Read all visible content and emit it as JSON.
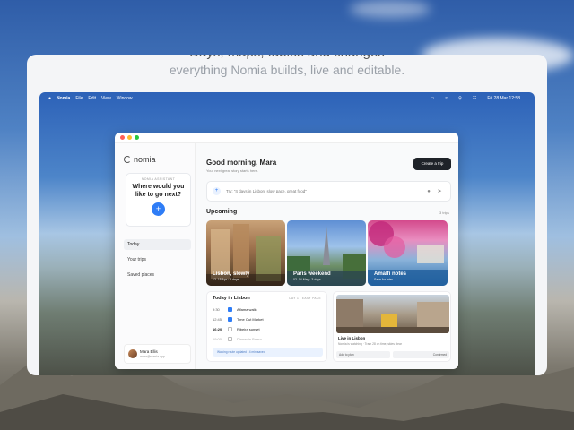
{
  "heading": {
    "line1": "Days, maps, tables and changes",
    "line2": "everything Nomia builds, live and editable."
  },
  "menubar": {
    "app": "Nomia",
    "items": [
      "File",
      "Edit",
      "View",
      "Window"
    ],
    "clock": "Fri 28 Mar 12:58"
  },
  "sidebar": {
    "logo": "nomia",
    "assistant_label": "NOMIA ASSISTANT",
    "assistant_question": "Where would you like to go next?",
    "nav": [
      "Today",
      "Your trips",
      "Saved places"
    ],
    "user_name": "Mara Ellis",
    "user_email": "mara@nomia.app"
  },
  "main": {
    "greeting": "Good morning, Mara",
    "subtitle": "Your next great story starts here.",
    "create_label": "Create a trip",
    "prompt_placeholder": "Try: \"4 days in Lisbon, slow pace, great food\"",
    "upcoming_title": "Upcoming",
    "upcoming_count": "3 trips",
    "trips": [
      {
        "name": "Lisbon, slowly",
        "date": "12–15 Apr · 4 days"
      },
      {
        "name": "Paris weekend",
        "date": "02–04 May · 3 days"
      },
      {
        "name": "Amalfi notes",
        "date": "Save for later"
      }
    ],
    "today": {
      "title": "Today in Lisbon",
      "day_label": "DAY 1 · EASY PACE",
      "items": [
        {
          "time": "9:30",
          "name": "Alfama walk",
          "done": true
        },
        {
          "time": "12:45",
          "name": "Time Out Market",
          "done": true
        },
        {
          "time": "16:20",
          "name": "Ribeira sunset",
          "done": false
        },
        {
          "time": "19:00",
          "name": "Dinner in Bairro",
          "done": false
        }
      ],
      "weather": "Walking route updated · 4 min saved"
    },
    "live": {
      "title": "Live in Lisbon",
      "subtitle": "Nomia is watching · Tram 28 on time, skies clear",
      "btn_left": "Add to plan",
      "btn_right": "Confirmed"
    }
  },
  "colors": {
    "accent": "#2f7df6",
    "dark_button": "#1f2329"
  }
}
